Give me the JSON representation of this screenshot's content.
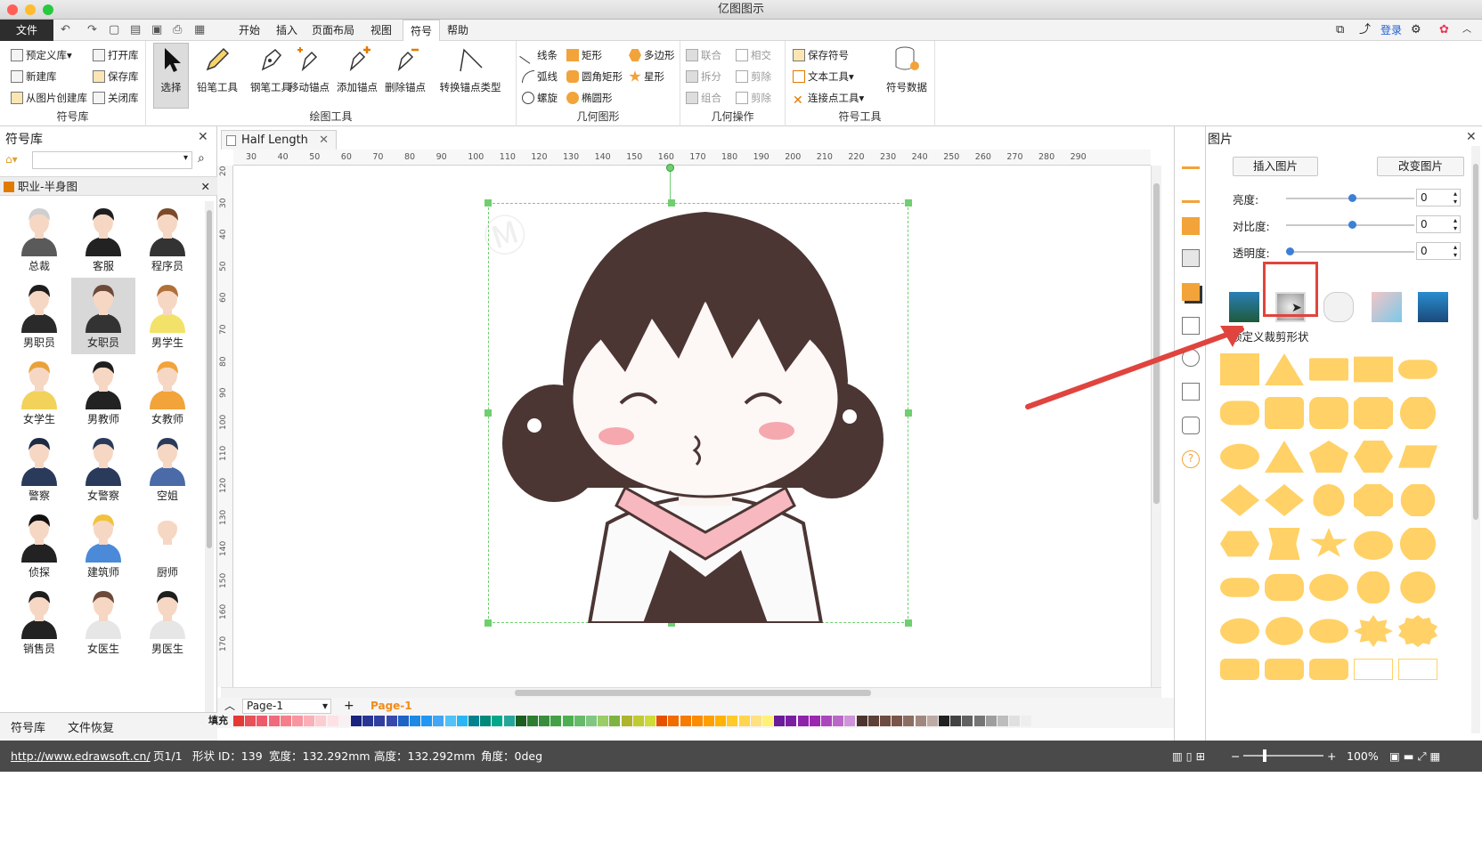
{
  "app": {
    "title": "亿图图示"
  },
  "menubar": {
    "file": "文件",
    "items": [
      {
        "label": "开始"
      },
      {
        "label": "插入"
      },
      {
        "label": "页面布局"
      },
      {
        "label": "视图"
      },
      {
        "label": "符号"
      },
      {
        "label": "帮助"
      }
    ],
    "active": "符号",
    "login": "登录"
  },
  "ribbon": {
    "symbol_library": {
      "label": "符号库",
      "items": [
        "预定义库",
        "新建库",
        "从图片创建库",
        "打开库",
        "保存库",
        "关闭库"
      ]
    },
    "draw_tools": {
      "label": "绘图工具",
      "items": [
        "选择",
        "铅笔工具",
        "钢笔工具",
        "移动锚点",
        "添加锚点",
        "删除锚点",
        "转换锚点类型"
      ]
    },
    "geometry": {
      "label": "几何图形",
      "items": [
        "线条",
        "弧线",
        "螺旋",
        "矩形",
        "圆角矩形",
        "椭圆形",
        "多边形",
        "星形"
      ]
    },
    "geo_ops": {
      "label": "几何操作",
      "items": [
        "联合",
        "相交",
        "拆分",
        "剪除",
        "组合",
        "剪除"
      ]
    },
    "symbol_tools": {
      "label": "符号工具",
      "items": [
        "保存符号",
        "文本工具",
        "连接点工具",
        "符号数据"
      ]
    }
  },
  "left_panel": {
    "title": "符号库",
    "category": "职业-半身图",
    "items": [
      "总裁",
      "客服",
      "程序员",
      "男职员",
      "女职员",
      "男学生",
      "女学生",
      "男教师",
      "女教师",
      "警察",
      "女警察",
      "空姐",
      "侦探",
      "建筑师",
      "厨师",
      "销售员",
      "女医生",
      "男医生"
    ],
    "selected": "女职员",
    "tabs": [
      "符号库",
      "文件恢复"
    ]
  },
  "document": {
    "tab": "Half Length",
    "ruler_h": [
      "30",
      "40",
      "50",
      "60",
      "70",
      "80",
      "90",
      "100",
      "110",
      "120",
      "130",
      "140",
      "150",
      "160",
      "170",
      "180",
      "190",
      "200",
      "210",
      "220",
      "230",
      "240",
      "250",
      "260",
      "270",
      "280",
      "290"
    ],
    "ruler_v": [
      "20",
      "30",
      "40",
      "50",
      "60",
      "70",
      "80",
      "90",
      "100",
      "110",
      "120",
      "130",
      "140",
      "150",
      "160",
      "170"
    ],
    "page_select": "Page-1",
    "page_tab": "Page-1",
    "fill_label": "填充"
  },
  "right_panel": {
    "title": "图片",
    "insert_btn": "插入图片",
    "change_btn": "改变图片",
    "brightness": {
      "label": "亮度:",
      "value": "0",
      "level": 0.5
    },
    "contrast": {
      "label": "对比度:",
      "value": "0",
      "level": 0.5
    },
    "transparency": {
      "label": "透明度:",
      "value": "0",
      "level": 0
    },
    "crop_label": "预定义裁剪形状",
    "shape_color": "#ffd166"
  },
  "status": {
    "url": "http://www.edrawsoft.cn/",
    "page": "页1/1",
    "shape_id": "形状 ID：139",
    "width": "宽度：132.292mm",
    "height": "高度：132.292mm",
    "angle": "角度：0deg",
    "zoom": "100%"
  },
  "colors": {
    "accent": "#3d7fd6",
    "highlight": "#e0443e",
    "shape": "#ffd166"
  }
}
